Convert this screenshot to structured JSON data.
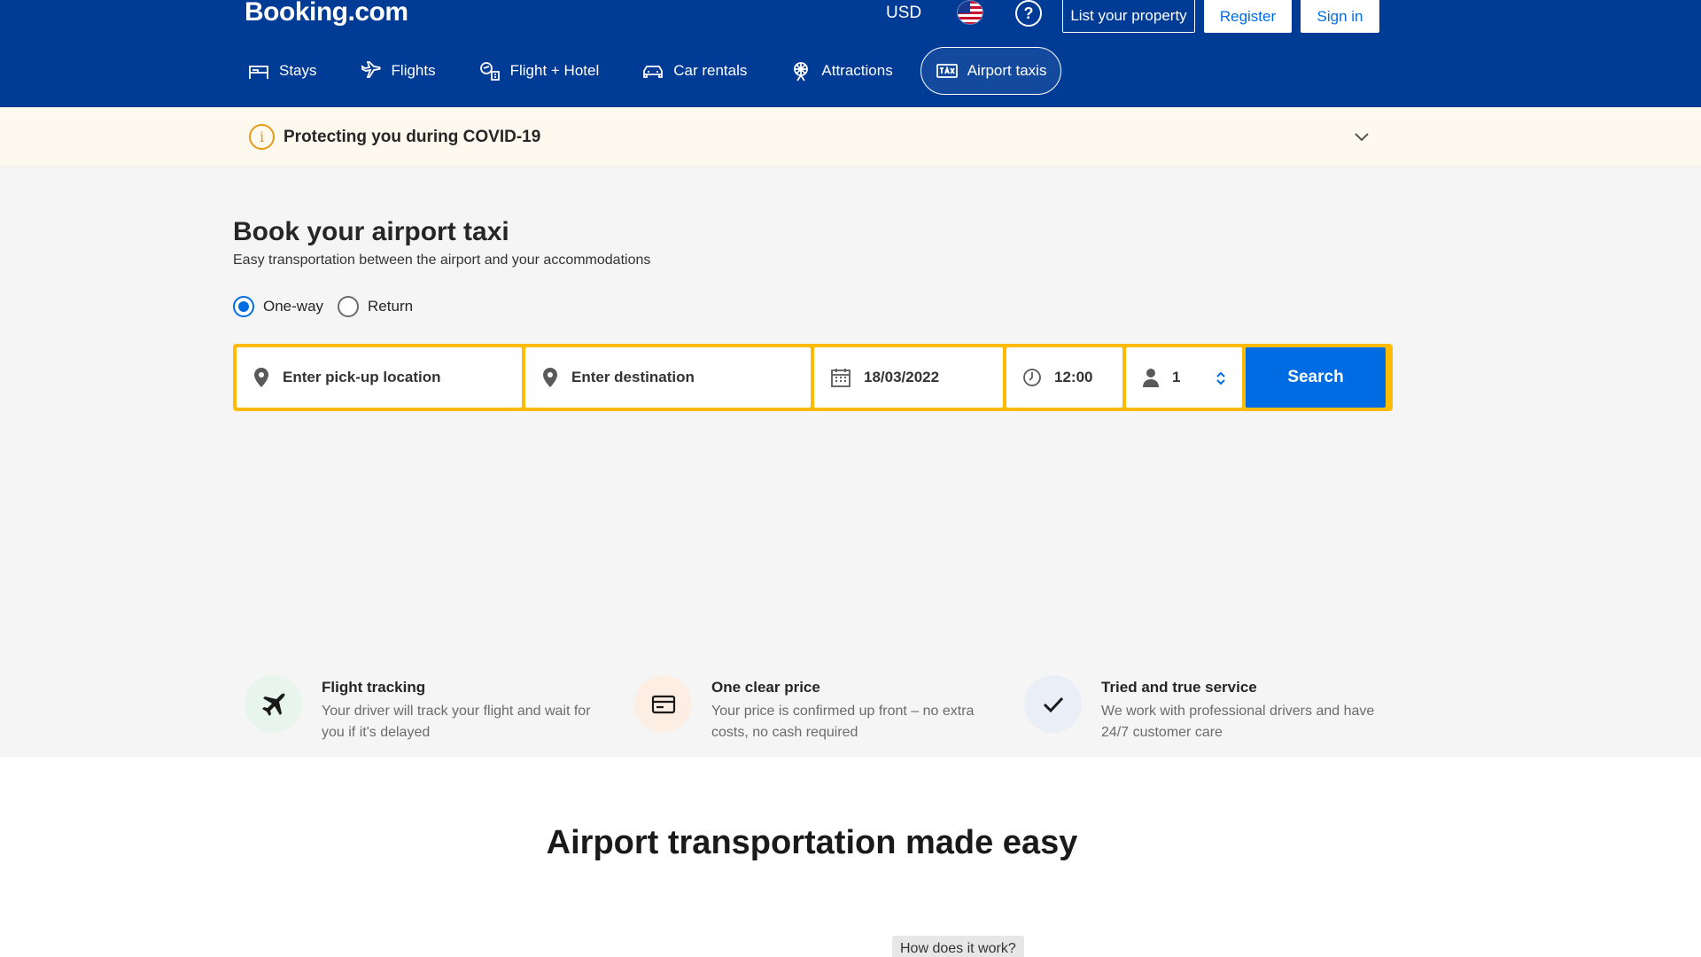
{
  "header": {
    "logo": "Booking.com",
    "currency": "USD",
    "help": "?",
    "list_property": "List your property",
    "register": "Register",
    "sign_in": "Sign in"
  },
  "nav": {
    "items": [
      {
        "label": "Stays",
        "icon": "bed-icon"
      },
      {
        "label": "Flights",
        "icon": "plane-icon"
      },
      {
        "label": "Flight + Hotel",
        "icon": "flight-hotel-icon"
      },
      {
        "label": "Car rentals",
        "icon": "car-icon"
      },
      {
        "label": "Attractions",
        "icon": "attractions-icon"
      },
      {
        "label": "Airport taxis",
        "icon": "taxi-icon",
        "active": true
      }
    ]
  },
  "covid": {
    "text": "Protecting you during COVID-19"
  },
  "hero": {
    "title": "Book your airport taxi",
    "subtitle": "Easy transportation between the airport and your accommodations",
    "trip_types": {
      "one_way": "One-way",
      "return": "Return",
      "selected": "One-way"
    },
    "search": {
      "pickup_placeholder": "Enter pick-up location",
      "destination_placeholder": "Enter destination",
      "date": "18/03/2022",
      "time": "12:00",
      "passengers": "1",
      "button": "Search"
    }
  },
  "features": [
    {
      "title": "Flight tracking",
      "text": "Your driver will track your flight and wait for you if it's delayed",
      "icon": "plane-icon"
    },
    {
      "title": "One clear price",
      "text": "Your price is confirmed up front – no extra costs, no cash required",
      "icon": "credit-card-icon"
    },
    {
      "title": "Tried and true service",
      "text": "We work with professional drivers and have 24/7 customer care",
      "icon": "checkmark-icon"
    }
  ],
  "section": {
    "title": "Airport transportation made easy",
    "how_button": "How does it work?"
  },
  "colors": {
    "brand": "#003b95",
    "accent": "#006ce4",
    "search_border": "#febb02",
    "covid_icon": "#e49b1a"
  }
}
